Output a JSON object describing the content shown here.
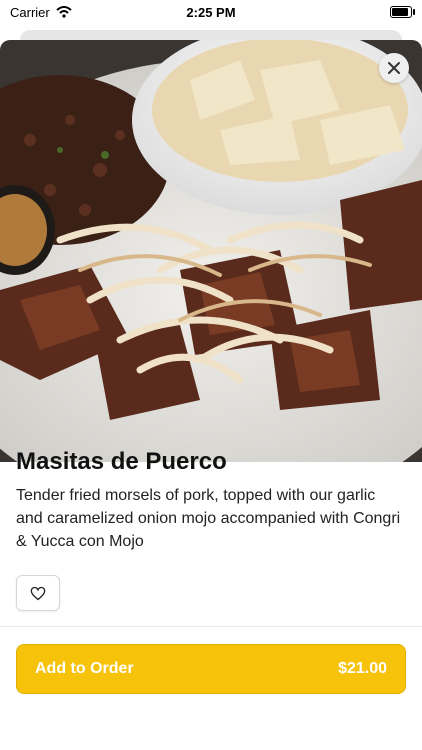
{
  "status_bar": {
    "carrier": "Carrier",
    "time": "2:25 PM"
  },
  "item": {
    "name": "Masitas de Puerco",
    "description": "Tender fried morsels of pork, topped with our garlic and caramelized onion mojo accompanied with Congri & Yucca con Mojo",
    "price": "$21.00"
  },
  "actions": {
    "add_label": "Add to Order"
  },
  "icons": {
    "close": "close-icon",
    "favorite": "heart-icon",
    "wifi": "wifi-icon",
    "battery": "battery-icon"
  },
  "colors": {
    "accent": "#f6c30a",
    "accent_text": "#ffffff"
  }
}
